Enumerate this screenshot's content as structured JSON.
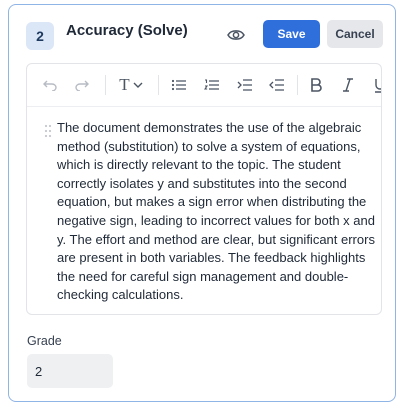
{
  "header": {
    "step_number": "2",
    "title": "Accuracy (Solve)",
    "save_label": "Save",
    "cancel_label": "Cancel"
  },
  "toolbar": {
    "icons": [
      "undo-icon",
      "redo-icon",
      "text-style-icon",
      "chevron-down-icon",
      "bullet-list-icon",
      "numbered-list-icon",
      "indent-icon",
      "outdent-icon",
      "bold-icon",
      "italic-icon",
      "underline-icon"
    ],
    "text_style_glyph": "T"
  },
  "editor": {
    "content": "The document demonstrates the use of the algebraic method (substitution) to solve a system of equations, which is directly relevant to the topic. The student correctly isolates y and substitutes into the second equation, but makes a sign error when distributing the negative sign, leading to incorrect values for both x and y. The effort and method are clear, but significant errors are present in both variables. The feedback highlights the need for careful sign management and double-checking calculations."
  },
  "grade": {
    "label": "Grade",
    "value": "2"
  },
  "colors": {
    "accent": "#2f6fdc",
    "card_border": "#8fb4e6",
    "badge_bg": "#dbe7f7"
  }
}
